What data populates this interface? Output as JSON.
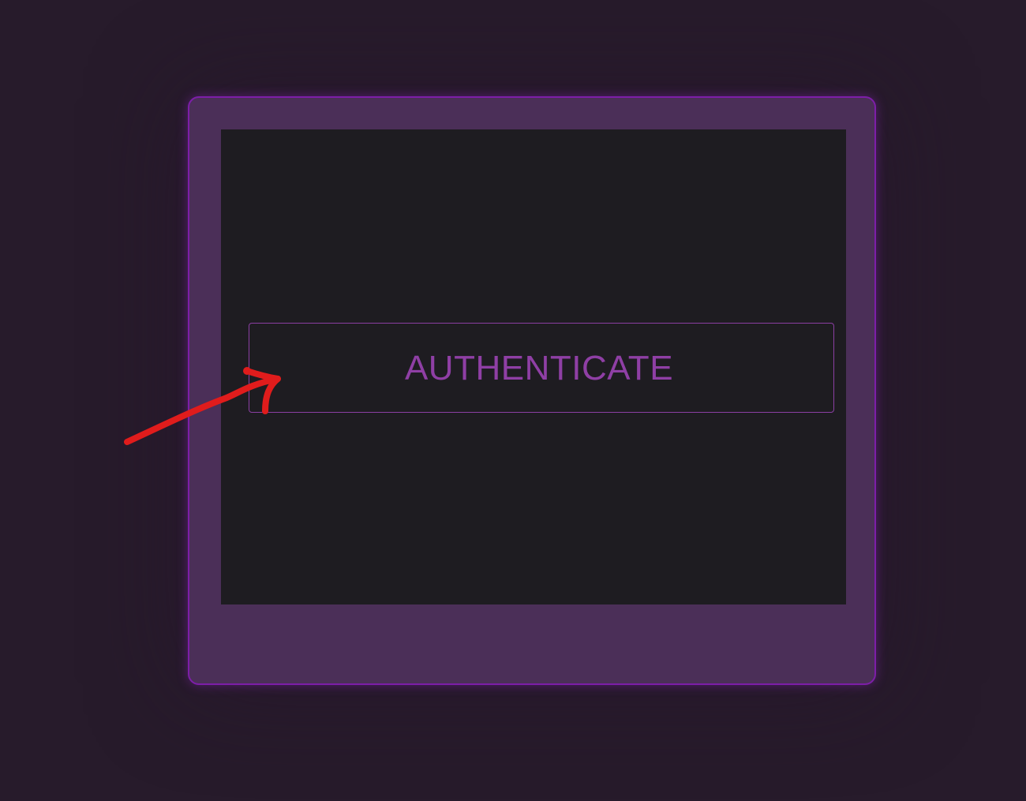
{
  "colors": {
    "background": "#271b2b",
    "frame": "#4b2f58",
    "frame_border": "#7d1ea8",
    "screen": "#1e1c21",
    "accent": "#8f3fa5",
    "annotation": "#e01c1c"
  },
  "auth_button": {
    "label": "AUTHENTICATE"
  },
  "annotation": {
    "icon": "arrow-icon"
  }
}
